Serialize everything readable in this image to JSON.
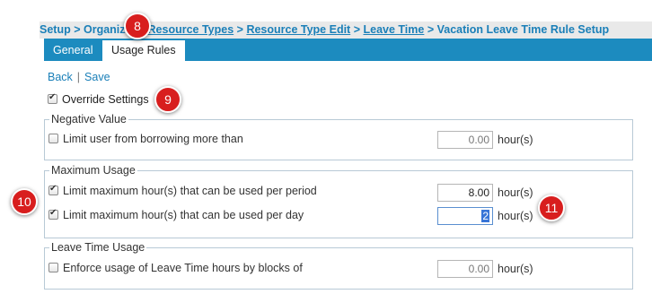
{
  "breadcrumb": {
    "setup": "Setup",
    "organization": "Organiz",
    "resource_types": "Resource Types",
    "resource_type_edit": "Resource Type Edit",
    "leave_time": "Leave Time",
    "current": "Vacation Leave Time Rule Setup",
    "sep": ">"
  },
  "tabs": {
    "general": "General",
    "usage_rules": "Usage Rules"
  },
  "actions": {
    "back": "Back",
    "save": "Save",
    "divider": "|"
  },
  "override_settings": {
    "label": "Override Settings",
    "checked": true
  },
  "negative_value": {
    "legend": "Negative Value",
    "limit_label": "Limit user from borrowing more than",
    "limit_checked": false,
    "value": "0.00",
    "unit": "hour(s)"
  },
  "maximum_usage": {
    "legend": "Maximum Usage",
    "per_period_label": "Limit maximum hour(s) that can be used per period",
    "per_period_checked": true,
    "per_period_value": "8.00",
    "per_day_label": "Limit maximum hour(s) that can be used per day",
    "per_day_checked": true,
    "per_day_value": "2",
    "unit": "hour(s)"
  },
  "leave_time_usage": {
    "legend": "Leave Time Usage",
    "blocks_label": "Enforce usage of Leave Time hours by blocks of",
    "blocks_checked": false,
    "value": "0.00",
    "unit": "hour(s)"
  },
  "callouts": {
    "c8": "8",
    "c9": "9",
    "c10": "10",
    "c11": "11"
  }
}
